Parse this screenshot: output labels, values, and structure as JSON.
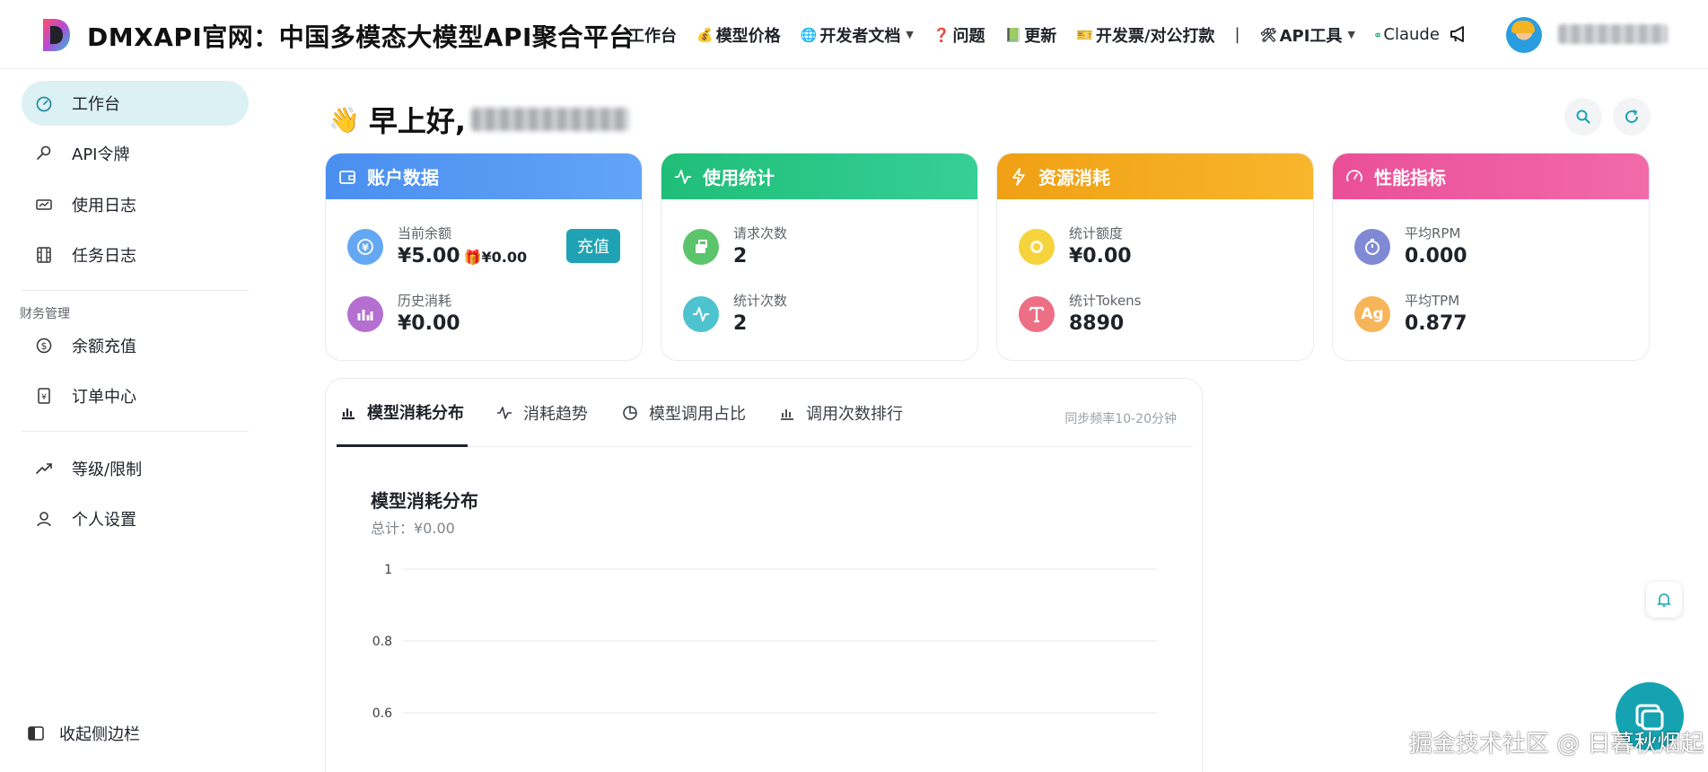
{
  "header": {
    "site_title": "DMXAPI官网：中国多模态大模型API聚合平台",
    "nav": [
      {
        "label": "工作台",
        "emoji": "",
        "caret": false
      },
      {
        "label": "模型价格",
        "emoji": "💰",
        "caret": false
      },
      {
        "label": "开发者文档",
        "emoji": "🌐",
        "caret": true
      },
      {
        "label": "问题",
        "emoji": "❓",
        "caret": false
      },
      {
        "label": "更新",
        "emoji": "📗",
        "caret": false
      },
      {
        "label": "开发票/对公打款",
        "emoji": "🎫",
        "caret": false
      },
      {
        "label": "API工具",
        "emoji": "🛠",
        "caret": true
      },
      {
        "label": "Claude",
        "emoji": "",
        "caret": false
      }
    ],
    "nav_separator": "|",
    "caret_glyph": "▼"
  },
  "sidebar": {
    "items": [
      {
        "label": "工作台",
        "icon": "dashboard-icon",
        "active": true
      },
      {
        "label": "API令牌",
        "icon": "key-icon",
        "active": false
      },
      {
        "label": "使用日志",
        "icon": "log-icon",
        "active": false
      },
      {
        "label": "任务日志",
        "icon": "film-icon",
        "active": false
      }
    ],
    "group_label": "财务管理",
    "finance_items": [
      {
        "label": "余额充值",
        "icon": "dollar-icon"
      },
      {
        "label": "订单中心",
        "icon": "order-icon"
      }
    ],
    "other_items": [
      {
        "label": "等级/限制",
        "icon": "trend-icon"
      },
      {
        "label": "个人设置",
        "icon": "user-icon"
      }
    ],
    "collapse_label": "收起侧边栏"
  },
  "greeting": {
    "wave": "👋",
    "text": "早上好,"
  },
  "cards": [
    {
      "title": "账户数据",
      "icon": "wallet-icon",
      "color_from": "#4a8ff0",
      "color_to": "#63a4f7",
      "stats": [
        {
          "label": "当前余额",
          "value": "¥5.00",
          "gift": "🎁¥0.00",
          "icon": "yen-icon",
          "circle": "#64a8f3"
        },
        {
          "label": "历史消耗",
          "value": "¥0.00",
          "icon": "bar-chart-icon",
          "circle": "#b56fd1"
        }
      ],
      "button": "充值"
    },
    {
      "title": "使用统计",
      "icon": "pulse-icon",
      "color_from": "#1fbe78",
      "color_to": "#36cf96",
      "stats": [
        {
          "label": "请求次数",
          "value": "2",
          "icon": "send-icon",
          "circle": "#5cc46a"
        },
        {
          "label": "统计次数",
          "value": "2",
          "icon": "pulse-icon",
          "circle": "#4ec3d0"
        }
      ]
    },
    {
      "title": "资源消耗",
      "icon": "bolt-icon",
      "color_from": "#f0a014",
      "color_to": "#f8b62c",
      "stats": [
        {
          "label": "统计额度",
          "value": "¥0.00",
          "icon": "coin-icon",
          "circle": "#f4d33c"
        },
        {
          "label": "统计Tokens",
          "value": "8890",
          "icon": "text-icon",
          "circle": "#ec6f86"
        }
      ]
    },
    {
      "title": "性能指标",
      "icon": "gauge-icon",
      "color_from": "#ea4f98",
      "color_to": "#f26aa9",
      "stats": [
        {
          "label": "平均RPM",
          "value": "0.000",
          "icon": "timer-icon",
          "circle": "#7f89d4"
        },
        {
          "label": "平均TPM",
          "value": "0.877",
          "icon": "ag-icon",
          "circle": "#f7b55a",
          "glyph": "Ag"
        }
      ]
    }
  ],
  "panel": {
    "tabs": [
      {
        "label": "模型消耗分布",
        "active": true
      },
      {
        "label": "消耗趋势",
        "active": false
      },
      {
        "label": "模型调用占比",
        "active": false
      },
      {
        "label": "调用次数排行",
        "active": false
      }
    ],
    "sync_note": "同步频率10-20分钟"
  },
  "chart_data": {
    "type": "bar",
    "title": "模型消耗分布",
    "subtitle": "总计：¥0.00",
    "categories": [],
    "series": [],
    "yticks": [
      "1",
      "0.8",
      "0.6"
    ],
    "ylim": [
      0,
      1
    ],
    "grid": true
  },
  "watermark": "掘金技术社区 @ 日暮秋烟起"
}
